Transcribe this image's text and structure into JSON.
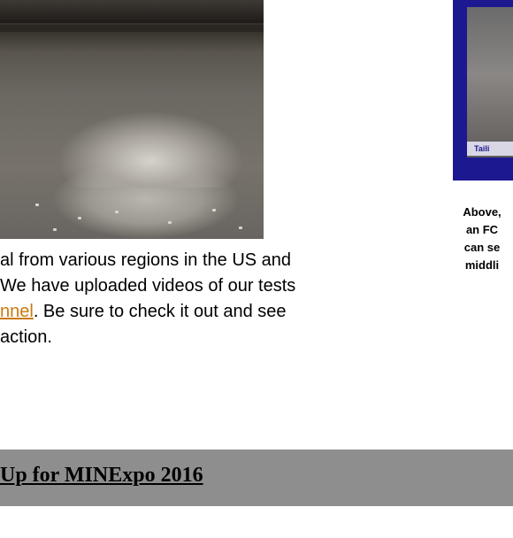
{
  "article": {
    "line1": "al from various regions in the US and",
    "line2": "We have uploaded videos of our tests",
    "link_text": "nnel",
    "line3_rest": ". Be sure to check it out and see",
    "line4": "action."
  },
  "side_image": {
    "tag": "Taili"
  },
  "caption": {
    "lines": [
      "Above,",
      "an FC",
      "can se",
      "middli"
    ]
  },
  "section": {
    "title": "Up for MINExpo 2016"
  },
  "colors": {
    "link": "#c97a10",
    "side_frame": "#1c1890",
    "section_bar": "#8e8e8e"
  }
}
